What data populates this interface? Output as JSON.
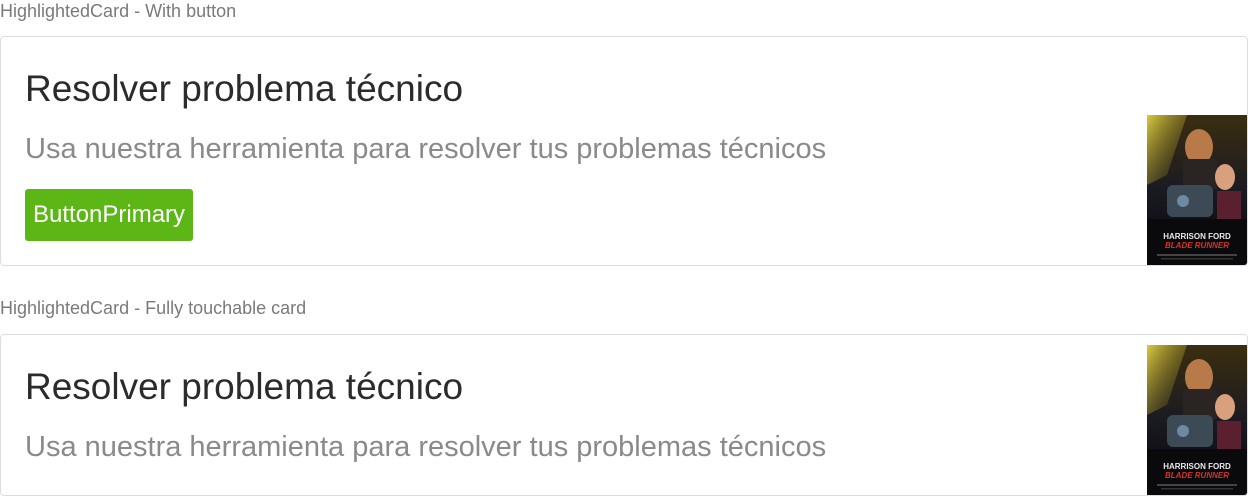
{
  "cards": [
    {
      "section_label": "HighlightedCard - With button",
      "title": "Resolver problema técnico",
      "description": "Usa nuestra herramienta para resolver tus problemas técnicos",
      "button_label": "ButtonPrimary",
      "poster": {
        "actor": "HARRISON FORD",
        "film": "BLADE RUNNER"
      }
    },
    {
      "section_label": "HighlightedCard - Fully touchable card",
      "title": "Resolver problema técnico",
      "description": "Usa nuestra herramienta para resolver tus problemas técnicos",
      "poster": {
        "actor": "HARRISON FORD",
        "film": "BLADE RUNNER"
      }
    }
  ],
  "colors": {
    "button_primary": "#5cb615",
    "title_text": "#2b2b2b",
    "description_text": "#8a8a8a",
    "section_label_text": "#7a7a7a",
    "card_border": "#dddddd"
  }
}
